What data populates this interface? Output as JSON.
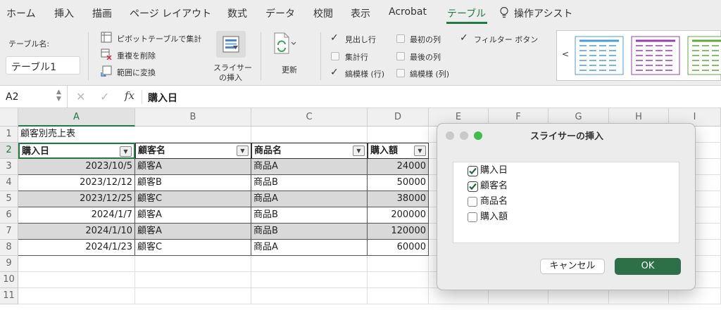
{
  "tabs": [
    "ホーム",
    "挿入",
    "描画",
    "ページ レイアウト",
    "数式",
    "データ",
    "校閲",
    "表示",
    "Acrobat",
    "テーブル",
    "操作アシスト"
  ],
  "active_tab": "テーブル",
  "ribbon": {
    "table_name_label": "テーブル名:",
    "table_name_value": "テーブル1",
    "pivot_label": "ピボットテーブルで集計",
    "remove_dup_label": "重複を削除",
    "convert_label": "範囲に変換",
    "slicer_label_1": "スライサー",
    "slicer_label_2": "の挿入",
    "refresh_label": "更新",
    "header_row_label": "見出し行",
    "total_row_label": "集計行",
    "banded_rows_label": "縞模様 (行)",
    "first_col_label": "最初の列",
    "last_col_label": "最後の列",
    "banded_cols_label": "縞模様 (列)",
    "filter_button_label": "フィルター ボタン",
    "header_row_checked": true,
    "total_row_checked": false,
    "banded_rows_checked": true,
    "first_col_checked": false,
    "last_col_checked": false,
    "banded_cols_checked": false,
    "filter_button_checked": true,
    "gallery_prev": "<",
    "style_colors": [
      "#4a9ed6",
      "#9b3fae",
      "#5fa83a"
    ]
  },
  "formula_bar": {
    "cell_ref": "A2",
    "fx": "fx",
    "value": "購入日"
  },
  "grid": {
    "columns": [
      "A",
      "B",
      "C",
      "D",
      "E",
      "F",
      "G",
      "H",
      "I"
    ],
    "rows": [
      "1",
      "2",
      "3",
      "4",
      "5",
      "6",
      "7",
      "8",
      "9",
      "10",
      "11"
    ],
    "title": "顧客別売上表",
    "headers": [
      "購入日",
      "顧客名",
      "商品名",
      "購入額"
    ],
    "data": [
      [
        "2023/10/5",
        "顧客A",
        "商品A",
        "24000"
      ],
      [
        "2023/12/12",
        "顧客B",
        "商品B",
        "50000"
      ],
      [
        "2023/12/25",
        "顧客C",
        "商品A",
        "38000"
      ],
      [
        "2024/1/7",
        "顧客A",
        "商品B",
        "200000"
      ],
      [
        "2024/1/10",
        "顧客A",
        "商品B",
        "120000"
      ],
      [
        "2024/1/23",
        "顧客C",
        "商品A",
        "60000"
      ]
    ]
  },
  "dialog": {
    "title": "スライサーの挿入",
    "items": [
      {
        "label": "購入日",
        "checked": true
      },
      {
        "label": "顧客名",
        "checked": true
      },
      {
        "label": "商品名",
        "checked": false
      },
      {
        "label": "購入額",
        "checked": false
      }
    ],
    "cancel_label": "キャンセル",
    "ok_label": "OK"
  }
}
